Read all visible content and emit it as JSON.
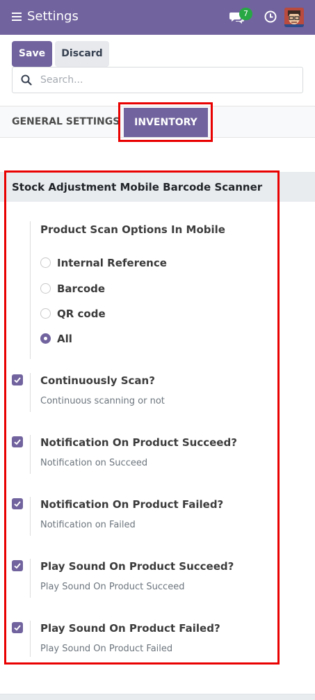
{
  "navbar": {
    "title": "Settings",
    "message_count": "7",
    "icons": [
      "menu-icon",
      "chat-icon",
      "clock-icon",
      "avatar"
    ],
    "brand_color": "#71639e"
  },
  "actions": {
    "save_label": "Save",
    "discard_label": "Discard"
  },
  "search": {
    "placeholder": "Search...",
    "value": ""
  },
  "tabs": [
    {
      "label": "GENERAL SETTINGS",
      "active": false
    },
    {
      "label": "INVENTORY",
      "active": true
    }
  ],
  "section": {
    "title": "Stock Adjustment Mobile Barcode Scanner",
    "scan_options": {
      "title": "Product Scan Options In Mobile",
      "options": [
        {
          "label": "Internal Reference",
          "selected": false
        },
        {
          "label": "Barcode",
          "selected": false
        },
        {
          "label": "QR code",
          "selected": false
        },
        {
          "label": "All",
          "selected": true
        }
      ]
    },
    "settings": [
      {
        "title": "Continuously Scan?",
        "description": "Continuous scanning or not",
        "checked": true
      },
      {
        "title": "Notification On Product Succeed?",
        "description": "Notification on Succeed",
        "checked": true
      },
      {
        "title": "Notification On Product Failed?",
        "description": "Notification on Failed",
        "checked": true
      },
      {
        "title": "Play Sound On Product Succeed?",
        "description": "Play Sound On Product Succeed",
        "checked": true
      },
      {
        "title": "Play Sound On Product Failed?",
        "description": "Play Sound On Product Failed",
        "checked": true
      }
    ]
  },
  "colors": {
    "accent": "#71639e",
    "highlight_border": "#e90000",
    "badge": "#28a745"
  }
}
